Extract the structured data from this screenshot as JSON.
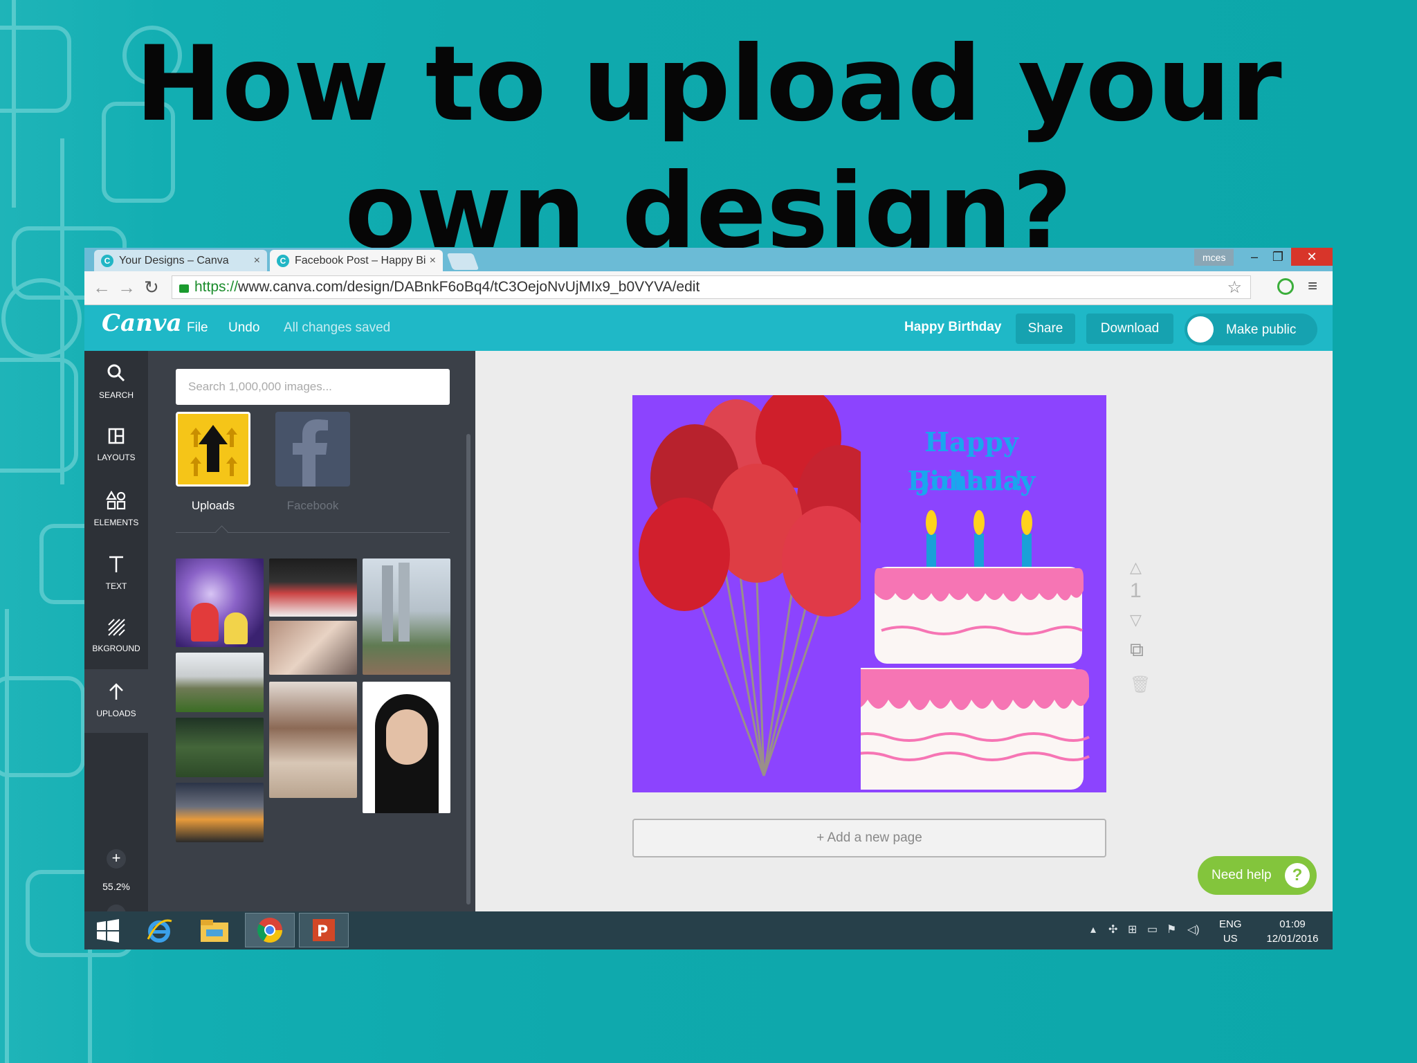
{
  "slide": {
    "title": "How to upload your own design?"
  },
  "browser": {
    "tabs": [
      {
        "label": "Your Designs – Canva",
        "close": "×"
      },
      {
        "label": "Facebook Post – Happy Bi",
        "close": "×"
      }
    ],
    "window_user": "mces",
    "url_scheme": "https://",
    "url_rest": "www.canva.com/design/DABnkF6oBq4/tC3OejoNvUjMIx9_b0VYVA/edit"
  },
  "canva": {
    "logo": "Canva",
    "menu": {
      "file": "File",
      "undo": "Undo",
      "status": "All changes saved"
    },
    "design_name": "Happy Birthday",
    "share": "Share",
    "download": "Download",
    "make_public": "Make public"
  },
  "rail": {
    "items": [
      {
        "label": "SEARCH",
        "icon": "search-icon"
      },
      {
        "label": "LAYOUTS",
        "icon": "layouts-icon"
      },
      {
        "label": "ELEMENTS",
        "icon": "elements-icon"
      },
      {
        "label": "TEXT",
        "icon": "text-icon"
      },
      {
        "label": "BKGROUND",
        "icon": "background-icon"
      },
      {
        "label": "UPLOADS",
        "icon": "upload-icon"
      }
    ],
    "zoom_in": "+",
    "zoom": "55.2%",
    "zoom_out": "−"
  },
  "panel": {
    "search_placeholder": "Search 1,000,000 images...",
    "sources": [
      {
        "label": "Uploads",
        "icon": "upload-arrow-icon"
      },
      {
        "label": "Facebook",
        "icon": "facebook-icon"
      }
    ]
  },
  "design": {
    "line1": "Happy Birthday",
    "line2": "Johan !"
  },
  "editor": {
    "page_number": "1",
    "add_page": "+ Add a new page",
    "need_help": "Need help",
    "help_icon": "?"
  },
  "taskbar": {
    "lang_top": "ENG",
    "lang_bottom": "US",
    "time": "01:09",
    "date": "12/01/2016"
  },
  "colors": {
    "canva_teal": "#1fb8c7",
    "design_bg": "#8c44fe",
    "design_text": "#1aa6ee",
    "need_help_green": "#83c53c"
  }
}
